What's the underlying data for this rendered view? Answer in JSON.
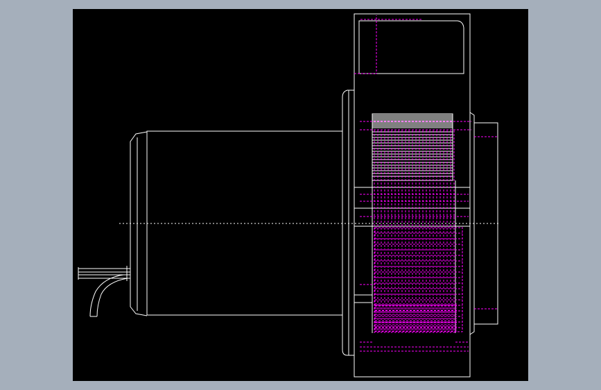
{
  "viewport": {
    "background_color": "#a5afbb",
    "canvas_color": "#000000"
  },
  "drawing": {
    "subject": "blower-motor-side-elevation",
    "line_color": "#ffffff",
    "hidden_line_color": "#ff00ff",
    "centerline_color": "#ffffff",
    "parts": [
      "motor-body",
      "motor-end-cap",
      "lead-wires",
      "mounting-flange",
      "blower-housing",
      "impeller-wheel",
      "outlet-duct",
      "bearing-boss",
      "centerline"
    ]
  }
}
